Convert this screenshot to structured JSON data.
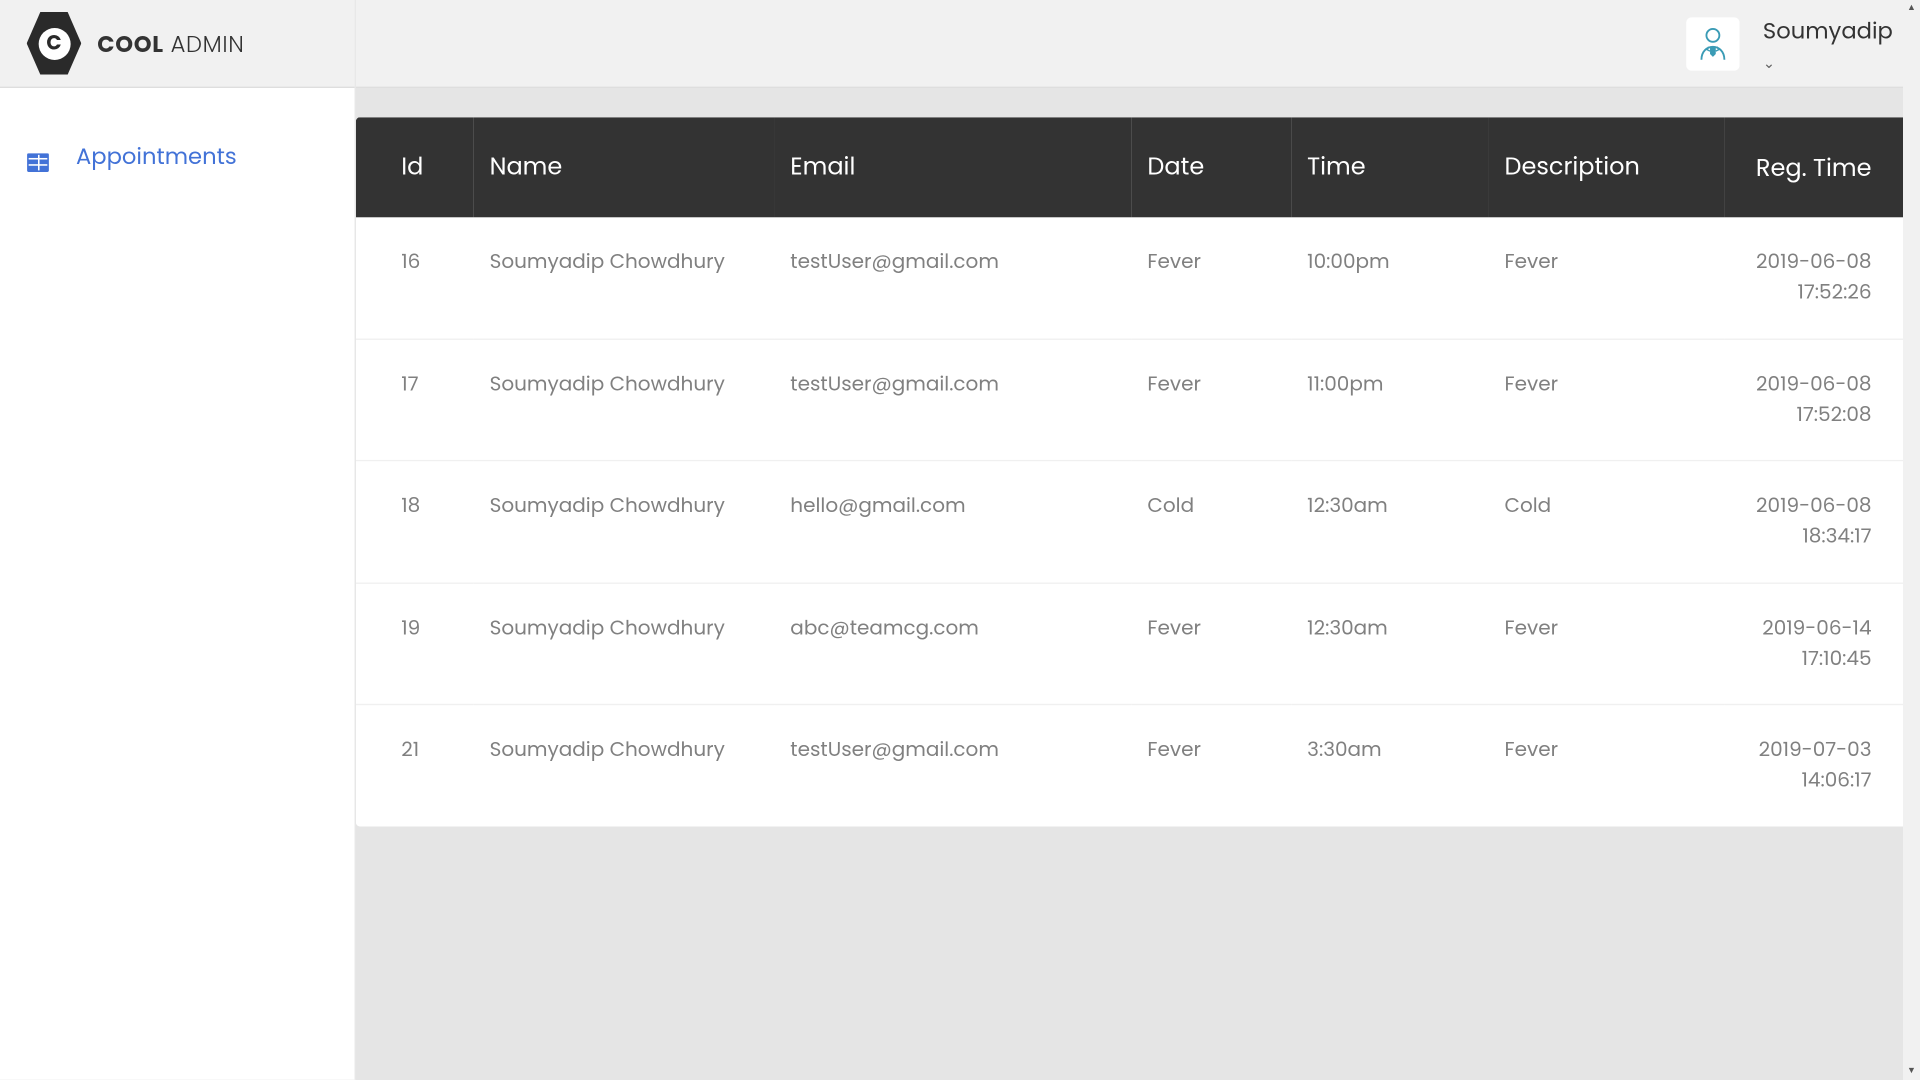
{
  "brand": {
    "bold": "COOL",
    "light": " ADMIN",
    "logo_letter": "C"
  },
  "sidebar": {
    "items": [
      {
        "label": "Appointments"
      }
    ]
  },
  "header": {
    "user_name": "Soumyadip"
  },
  "table": {
    "headers": {
      "id": "Id",
      "name": "Name",
      "email": "Email",
      "date": "Date",
      "time": "Time",
      "description": "Description",
      "reg_time": "Reg. Time"
    },
    "rows": [
      {
        "id": "16",
        "name": "Soumyadip Chowdhury",
        "email": "testUser@gmail.com",
        "date": "Fever",
        "time": "10:00pm",
        "description": "Fever",
        "reg_time": "2019-06-08 17:52:26"
      },
      {
        "id": "17",
        "name": "Soumyadip Chowdhury",
        "email": "testUser@gmail.com",
        "date": "Fever",
        "time": "11:00pm",
        "description": "Fever",
        "reg_time": "2019-06-08 17:52:08"
      },
      {
        "id": "18",
        "name": "Soumyadip Chowdhury",
        "email": "hello@gmail.com",
        "date": "Cold",
        "time": "12:30am",
        "description": "Cold",
        "reg_time": "2019-06-08 18:34:17"
      },
      {
        "id": "19",
        "name": "Soumyadip Chowdhury",
        "email": "abc@teamcg.com",
        "date": "Fever",
        "time": "12:30am",
        "description": "Fever",
        "reg_time": "2019-06-14 17:10:45"
      },
      {
        "id": "21",
        "name": "Soumyadip Chowdhury",
        "email": "testUser@gmail.com",
        "date": "Fever",
        "time": "3:30am",
        "description": "Fever",
        "reg_time": "2019-07-03 14:06:17"
      }
    ]
  }
}
